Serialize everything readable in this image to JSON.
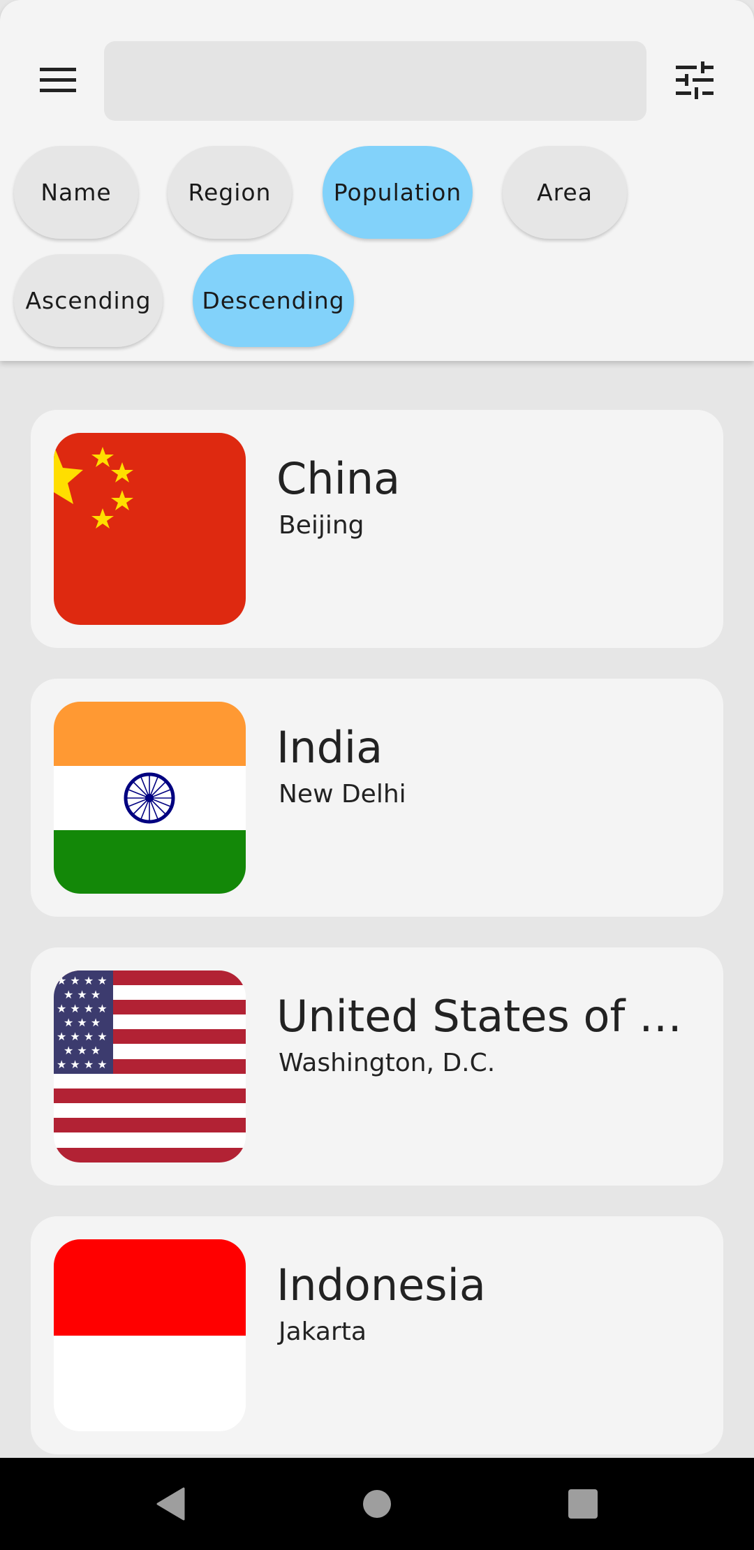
{
  "search": {
    "value": "",
    "placeholder": ""
  },
  "header": {
    "menu_icon": "menu-icon",
    "filter_icon": "tune-icon"
  },
  "sort_chips": [
    {
      "label": "Name",
      "selected": false
    },
    {
      "label": "Region",
      "selected": false
    },
    {
      "label": "Population",
      "selected": true
    },
    {
      "label": "Area",
      "selected": false
    }
  ],
  "order_chips": [
    {
      "label": "Ascending",
      "selected": false
    },
    {
      "label": "Descending",
      "selected": true
    }
  ],
  "countries": [
    {
      "name": "China",
      "capital": "Beijing",
      "flag": "china-flag"
    },
    {
      "name": "India",
      "capital": "New Delhi",
      "flag": "india-flag"
    },
    {
      "name": "United States of America",
      "capital": "Washington, D.C.",
      "flag": "usa-flag"
    },
    {
      "name": "Indonesia",
      "capital": "Jakarta",
      "flag": "indonesia-flag"
    }
  ],
  "navigation": {
    "back_icon": "back-triangle-icon",
    "home_icon": "home-circle-icon",
    "recents_icon": "recents-square-icon"
  },
  "colors": {
    "chip_selected": "#82d2fa",
    "chip_default": "#e6e6e6",
    "card_bg": "#f4f4f4",
    "page_bg": "#e6e6e6"
  }
}
